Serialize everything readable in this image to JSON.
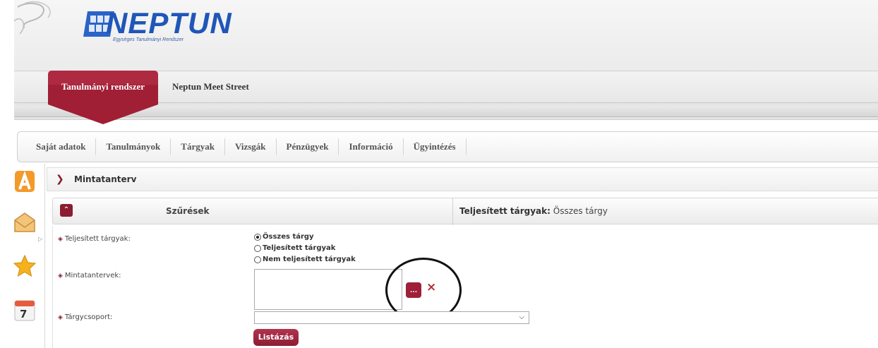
{
  "brand": {
    "name": "NEPTUN",
    "subtitle": "Egységes Tanulmányi Rendszer"
  },
  "top_tabs": [
    {
      "label": "Tanulmányi rendszer",
      "active": true
    },
    {
      "label": "Neptun Meet Street",
      "active": false
    }
  ],
  "menu": [
    {
      "label": "Saját adatok"
    },
    {
      "label": "Tanulmányok"
    },
    {
      "label": "Tárgyak"
    },
    {
      "label": "Vizsgák"
    },
    {
      "label": "Pénzügyek"
    },
    {
      "label": "Információ"
    },
    {
      "label": "Ügyintézés"
    }
  ],
  "side_icons": [
    "a-letter-icon",
    "envelope-icon",
    "star-icon",
    "calendar-icon"
  ],
  "calendar_day": "7",
  "page": {
    "title": "Mintatanterv"
  },
  "filters": {
    "label": "Szűrések",
    "status_label": "Teljesített tárgyak:",
    "status_value": "Összes tárgy"
  },
  "form": {
    "completed_label": "Teljesített tárgyak:",
    "radio_options": [
      {
        "label": "Összes tárgy",
        "selected": true
      },
      {
        "label": "Teljesített tárgyak",
        "selected": false
      },
      {
        "label": "Nem teljesített tárgyak",
        "selected": false
      }
    ],
    "curricula_label": "Mintatantervek:",
    "picker_button_label": "...",
    "clear_symbol": "×",
    "subject_group_label": "Tárgycsoport:",
    "subject_group_value": "",
    "list_button_label": "Listázás"
  },
  "colors": {
    "accent": "#8c1c30",
    "brand_blue": "#1f56b8"
  }
}
